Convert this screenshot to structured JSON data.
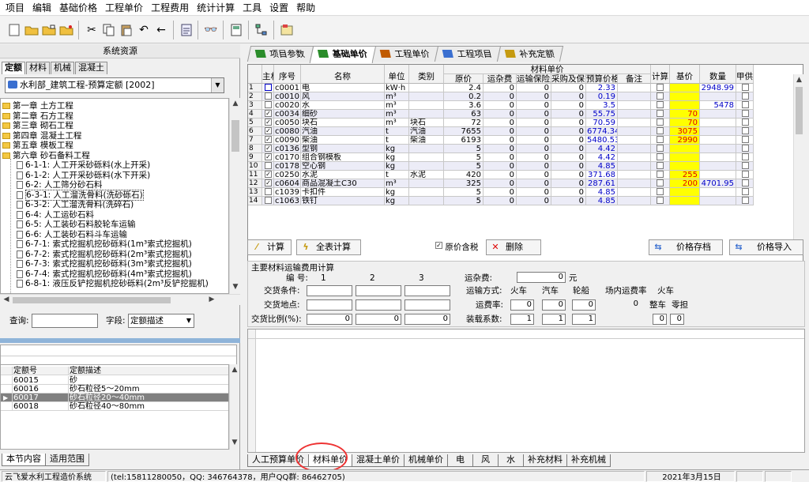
{
  "menu": [
    "项目",
    "编辑",
    "基础价格",
    "工程单价",
    "工程费用",
    "统计计算",
    "工具",
    "设置",
    "帮助"
  ],
  "left": {
    "title": "系统资源",
    "tabs": [
      "定额",
      "材料",
      "机械",
      "混凝土"
    ],
    "combo": "水利部_建筑工程-预算定额 [2002]",
    "tree": [
      {
        "t": "第一章 土方工程",
        "lvl": 0,
        "kind": "folder"
      },
      {
        "t": "第二章 石方工程",
        "lvl": 0,
        "kind": "folder"
      },
      {
        "t": "第三章 砌石工程",
        "lvl": 0,
        "kind": "folder"
      },
      {
        "t": "第四章 混凝土工程",
        "lvl": 0,
        "kind": "folder"
      },
      {
        "t": "第五章 模板工程",
        "lvl": 0,
        "kind": "folder"
      },
      {
        "t": "第六章 砂石备料工程",
        "lvl": 0,
        "kind": "folder"
      },
      {
        "t": "6-1-1: 人工开采砂砾料(水上开采)",
        "lvl": 1,
        "kind": "doc"
      },
      {
        "t": "6-1-2: 人工开采砂砾料(水下开采)",
        "lvl": 1,
        "kind": "doc"
      },
      {
        "t": "6-2: 人工筛分砂石料",
        "lvl": 1,
        "kind": "doc"
      },
      {
        "t": "6-3-1: 人工溜洗骨料(洗砂砾石)",
        "lvl": 1,
        "kind": "doc",
        "sel": true
      },
      {
        "t": "6-3-2: 人工溜洗骨料(洗碎石)",
        "lvl": 1,
        "kind": "doc"
      },
      {
        "t": "6-4: 人工运砂石料",
        "lvl": 1,
        "kind": "doc"
      },
      {
        "t": "6-5: 人工装砂石料胶轮车运输",
        "lvl": 1,
        "kind": "doc"
      },
      {
        "t": "6-6: 人工装砂石料斗车运输",
        "lvl": 1,
        "kind": "doc"
      },
      {
        "t": "6-7-1: 索式挖掘机挖砂砾料(1m³索式挖掘机)",
        "lvl": 1,
        "kind": "doc"
      },
      {
        "t": "6-7-2: 索式挖掘机挖砂砾料(2m³索式挖掘机)",
        "lvl": 1,
        "kind": "doc"
      },
      {
        "t": "6-7-3: 索式挖掘机挖砂砾料(3m³索式挖掘机)",
        "lvl": 1,
        "kind": "doc"
      },
      {
        "t": "6-7-4: 索式挖掘机挖砂砾料(4m³索式挖掘机)",
        "lvl": 1,
        "kind": "doc"
      },
      {
        "t": "6-8-1: 液压反铲挖掘机挖砂砾料(2m³反铲挖掘机)",
        "lvl": 1,
        "kind": "doc"
      }
    ],
    "query_label": "查询:",
    "field_label": "字段:",
    "field_value": "定额描述",
    "codes_header": [
      "定额号",
      "定额描述"
    ],
    "codes": [
      {
        "code": "60015",
        "desc": "砂"
      },
      {
        "code": "60016",
        "desc": "砂石粒径5～20mm"
      },
      {
        "code": "60017",
        "desc": "砂石粒径20～40mm",
        "sel": true
      },
      {
        "code": "60018",
        "desc": "砂石粒径40～80mm"
      }
    ],
    "bottom_tabs": [
      "本节内容",
      "适用范围"
    ]
  },
  "right": {
    "tabs": [
      "项目参数",
      "基础单价",
      "工程单价",
      "工程项目",
      "补充定额"
    ],
    "active_tab": "基础单价",
    "group_header": "材料单价",
    "columns": [
      "主材",
      "序号",
      "名称",
      "单位",
      "类别",
      "原价",
      "运杂费",
      "运输保险费",
      "采购及保管费",
      "预算价格",
      "备注",
      "计算",
      "基价",
      "数量",
      "甲供"
    ],
    "rows": [
      {
        "i": "1",
        "cur": true,
        "main": false,
        "no": "c0001",
        "name": "电",
        "unit": "kW·h",
        "cat": "",
        "price": "2.4",
        "f1": "0",
        "f2": "0",
        "f3": "0",
        "budget": "2.33",
        "calc": false,
        "base": "",
        "qty": "2948.99"
      },
      {
        "i": "2",
        "main": false,
        "no": "c0010",
        "name": "风",
        "unit": "m³",
        "cat": "",
        "price": "0.2",
        "f1": "0",
        "f2": "0",
        "f3": "0",
        "budget": "0.19",
        "calc": false,
        "base": "",
        "qty": ""
      },
      {
        "i": "3",
        "main": false,
        "no": "c0020",
        "name": "水",
        "unit": "m³",
        "cat": "",
        "price": "3.6",
        "f1": "0",
        "f2": "0",
        "f3": "0",
        "budget": "3.5",
        "calc": false,
        "base": "",
        "qty": "5478"
      },
      {
        "i": "4",
        "main": true,
        "no": "c0034",
        "name": "细砂",
        "unit": "m³",
        "cat": "",
        "price": "63",
        "f1": "0",
        "f2": "0",
        "f3": "0",
        "budget": "55.75",
        "calc": false,
        "base": "70",
        "qty": ""
      },
      {
        "i": "5",
        "main": true,
        "no": "c0050",
        "name": "块石",
        "unit": "m³",
        "cat": "块石",
        "price": "72",
        "f1": "0",
        "f2": "0",
        "f3": "0",
        "budget": "70.59",
        "calc": false,
        "base": "70",
        "qty": ""
      },
      {
        "i": "6",
        "main": true,
        "no": "c0080",
        "name": "汽油",
        "unit": "t",
        "cat": "汽油",
        "price": "7655",
        "f1": "0",
        "f2": "0",
        "f3": "0",
        "budget": "6774.34",
        "calc": false,
        "base": "3075",
        "qty": ""
      },
      {
        "i": "7",
        "main": true,
        "no": "c0090",
        "name": "柴油",
        "unit": "t",
        "cat": "柴油",
        "price": "6193",
        "f1": "0",
        "f2": "0",
        "f3": "0",
        "budget": "5480.53",
        "calc": false,
        "base": "2990",
        "qty": ""
      },
      {
        "i": "8",
        "main": true,
        "no": "c0136",
        "name": "型钢",
        "unit": "kg",
        "cat": "",
        "price": "5",
        "f1": "0",
        "f2": "0",
        "f3": "0",
        "budget": "4.42",
        "calc": false,
        "base": "",
        "qty": ""
      },
      {
        "i": "9",
        "main": true,
        "no": "c0170",
        "name": "组合钢模板",
        "unit": "kg",
        "cat": "",
        "price": "5",
        "f1": "0",
        "f2": "0",
        "f3": "0",
        "budget": "4.42",
        "calc": false,
        "base": "",
        "qty": ""
      },
      {
        "i": "10",
        "main": false,
        "no": "c0178",
        "name": "空心钢",
        "unit": "kg",
        "cat": "",
        "price": "5",
        "f1": "0",
        "f2": "0",
        "f3": "0",
        "budget": "4.85",
        "calc": false,
        "base": "",
        "qty": ""
      },
      {
        "i": "11",
        "main": true,
        "no": "c0250",
        "name": "水泥",
        "unit": "t",
        "cat": "水泥",
        "price": "420",
        "f1": "0",
        "f2": "0",
        "f3": "0",
        "budget": "371.68",
        "calc": false,
        "base": "255",
        "qty": ""
      },
      {
        "i": "12",
        "main": true,
        "no": "c0604",
        "name": "商品混凝土C30",
        "unit": "m³",
        "cat": "",
        "price": "325",
        "f1": "0",
        "f2": "0",
        "f3": "0",
        "budget": "287.61",
        "calc": false,
        "base": "200",
        "qty": "4701.95"
      },
      {
        "i": "13",
        "main": false,
        "no": "c1039",
        "name": "卡扣件",
        "unit": "kg",
        "cat": "",
        "price": "5",
        "f1": "0",
        "f2": "0",
        "f3": "0",
        "budget": "4.85",
        "calc": false,
        "base": "",
        "qty": ""
      },
      {
        "i": "14",
        "main": false,
        "no": "c1063",
        "name": "铁钉",
        "unit": "kg",
        "cat": "",
        "price": "5",
        "f1": "0",
        "f2": "0",
        "f3": "0",
        "budget": "4.85",
        "calc": false,
        "base": "",
        "qty": ""
      }
    ],
    "actions": {
      "calc": "计算",
      "calc_all": "全表计算",
      "orig_tax": "原价含税",
      "delete": "删除",
      "save": "价格存档",
      "import": "价格导入"
    },
    "transport": {
      "title": "主要材料运输费用计算",
      "no_label": "编 号:",
      "nos": [
        "1",
        "2",
        "3"
      ],
      "cond_label": "交货条件:",
      "place_label": "交货地点:",
      "ratio_label": "交货比例(%):",
      "ratios": [
        "0",
        "0",
        "0"
      ],
      "misc_label": "运杂费:",
      "misc_value": "0",
      "misc_unit": "元",
      "mode_label": "运输方式:",
      "modes": [
        "火车",
        "汽车",
        "轮船",
        "场内运费率",
        "火车"
      ],
      "rate_label": "运费率:",
      "rates": [
        "0",
        "0",
        "0",
        "0"
      ],
      "load_label": "装载系数:",
      "loads": [
        "1",
        "1",
        "1"
      ],
      "train_sub": [
        "整车",
        "零担"
      ],
      "train_vals": [
        "0",
        "0"
      ]
    },
    "bottom_tabs": [
      "人工预算单价",
      "材料单价",
      "混凝土单价",
      "机械单价",
      "电",
      "风",
      "水",
      "补充材料",
      "补充机械"
    ],
    "active_bottom": "材料单价"
  },
  "status": {
    "left": "云飞爱水利工程造价系统",
    "contact": "(tel:15811280050，QQ: 346764378，用户QQ群: 86462705)",
    "date": "2021年3月15日"
  }
}
